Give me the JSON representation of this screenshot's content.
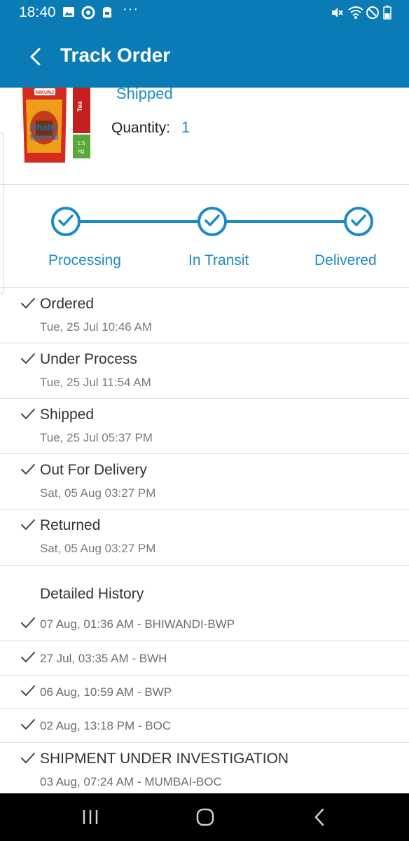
{
  "status_bar": {
    "time": "18:40",
    "icons": [
      "gallery-icon",
      "chrome-icon",
      "store-icon",
      "more-icon",
      "mute-icon",
      "wifi-icon",
      "dnd-icon",
      "battery-icon"
    ],
    "more": "···"
  },
  "app_bar": {
    "title": "Track Order",
    "back_icon": "back-arrow-icon"
  },
  "product": {
    "status": "Shipped",
    "quantity_label": "Quantity:",
    "quantity_value": "1",
    "image_brand": "NIKUNJ",
    "image_name_line1": "Dhaba",
    "image_name_line2": "special",
    "image_tag": "Tea",
    "image_weight_line1": "1.5",
    "image_weight_line2": "kg"
  },
  "stepper": {
    "steps": [
      {
        "label": "Processing",
        "done": true
      },
      {
        "label": "In Transit",
        "done": true
      },
      {
        "label": "Delivered",
        "done": true
      }
    ]
  },
  "timeline": [
    {
      "title": "Ordered",
      "time": "Tue, 25 Jul 10:46 AM"
    },
    {
      "title": "Under Process",
      "time": "Tue, 25 Jul 11:54 AM"
    },
    {
      "title": "Shipped",
      "time": "Tue, 25 Jul 05:37 PM"
    },
    {
      "title": "Out For Delivery",
      "time": "Sat, 05 Aug 03:27 PM"
    },
    {
      "title": "Returned",
      "time": "Sat, 05 Aug 03:27 PM"
    }
  ],
  "history": {
    "heading": "Detailed History",
    "entries": [
      {
        "text": "07 Aug, 01:36 AM - BHIWANDI-BWP"
      },
      {
        "text": "27 Jul, 03:35 AM - BWH"
      },
      {
        "text": "06 Aug, 10:59 AM - BWP"
      },
      {
        "text": "02 Aug, 13:18 PM - BOC"
      },
      {
        "title": "SHIPMENT UNDER INVESTIGATION",
        "text": "03 Aug, 07:24 AM - MUMBAI-BOC"
      }
    ]
  },
  "nav_bar": {
    "buttons": [
      "recents-icon",
      "home-icon",
      "back-icon"
    ]
  },
  "colors": {
    "primary": "#0a7bb5",
    "accent": "#1a8bc7"
  }
}
